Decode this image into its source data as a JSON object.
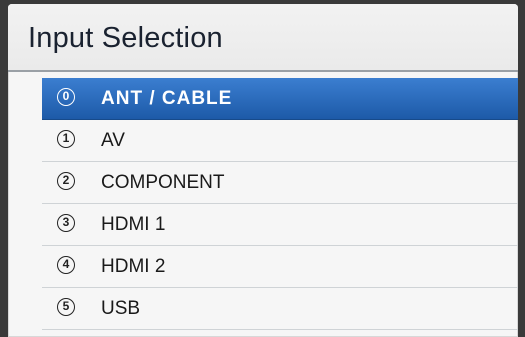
{
  "header": {
    "title": "Input Selection"
  },
  "inputs": [
    {
      "index": "0",
      "label": "ANT / CABLE",
      "selected": true
    },
    {
      "index": "1",
      "label": "AV",
      "selected": false
    },
    {
      "index": "2",
      "label": "COMPONENT",
      "selected": false
    },
    {
      "index": "3",
      "label": "HDMI 1",
      "selected": false
    },
    {
      "index": "4",
      "label": "HDMI 2",
      "selected": false
    },
    {
      "index": "5",
      "label": "USB",
      "selected": false
    }
  ],
  "colors": {
    "selection": "#2a6cc0",
    "panel": "#f6f6f6"
  }
}
